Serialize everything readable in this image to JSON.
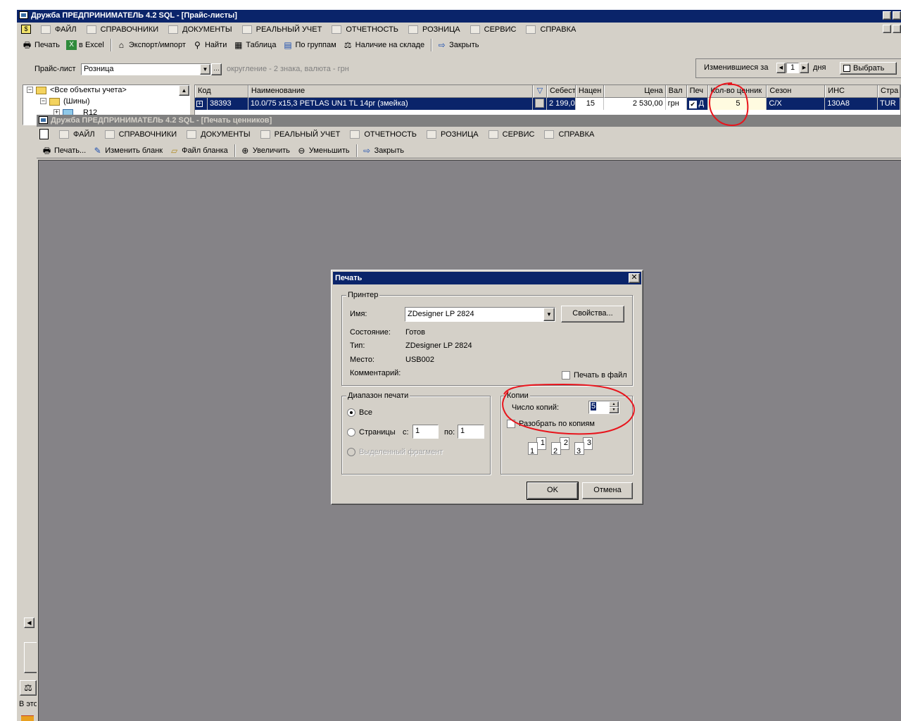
{
  "main_window": {
    "title": "Дружба  ПРЕДПРИНИМАТЕЛЬ 4.2 SQL - [Прайс-листы]",
    "menu": [
      "ФАЙЛ",
      "СПРАВОЧНИКИ",
      "ДОКУМЕНТЫ",
      "РЕАЛЬНЫЙ УЧЕТ",
      "ОТЧЕТНОСТЬ",
      "РОЗНИЦА",
      "СЕРВИС",
      "СПРАВКА"
    ],
    "toolbar": [
      "Печать",
      "в Excel",
      "Экспорт/импорт",
      "Найти",
      "Таблица",
      "По группам",
      "Наличие на складе",
      "Закрыть"
    ],
    "pricelist_label": "Прайс-лист",
    "pricelist_value": "Розница",
    "rounding_info": "округление - 2 знака, валюта - грн",
    "changed_label": "Изменившиеся за",
    "changed_days": "1",
    "days_label": "дня",
    "choose_label": "Выбрать",
    "tree": {
      "root": "<Все объекты учета>",
      "child": "(Шины)",
      "leaf": "R12"
    },
    "grid": {
      "columns": [
        "Код",
        "Наименование",
        "Себест",
        "Нацен",
        "Цена",
        "Вал",
        "Печ",
        "Кол-во ценник",
        "Сезон",
        "ИНС",
        "Стра"
      ],
      "row": {
        "code": "38393",
        "name": "10.0/75  x15,3 PETLAS UN1 TL 14pr (змейка)",
        "cost": "2 199,0",
        "markup": "15",
        "price": "2 530,00",
        "currency": "грн",
        "print": "Д",
        "qty": "5",
        "season": "C/X",
        "ins": "130A8",
        "country": "TUR"
      }
    },
    "status_partial": "В это"
  },
  "print_window": {
    "title": "Дружба  ПРЕДПРИНИМАТЕЛЬ 4.2 SQL - [Печать ценников]",
    "menu": [
      "ФАЙЛ",
      "СПРАВОЧНИКИ",
      "ДОКУМЕНТЫ",
      "РЕАЛЬНЫЙ УЧЕТ",
      "ОТЧЕТНОСТЬ",
      "РОЗНИЦА",
      "СЕРВИС",
      "СПРАВКА"
    ],
    "toolbar": [
      "Печать...",
      "Изменить бланк",
      "Файл бланка",
      "Увеличить",
      "Уменьшить",
      "Закрыть"
    ]
  },
  "dialog": {
    "title": "Печать",
    "printer_group": "Принтер",
    "name_label": "Имя:",
    "printer_name": "ZDesigner LP 2824",
    "properties_button": "Свойства...",
    "status_label": "Состояние:",
    "status_value": "Готов",
    "type_label": "Тип:",
    "type_value": "ZDesigner LP 2824",
    "where_label": "Место:",
    "where_value": "USB002",
    "comment_label": "Комментарий:",
    "print_to_file": "Печать в файл",
    "range_group": "Диапазон печати",
    "range_all": "Все",
    "range_pages": "Страницы",
    "from_label": "с:",
    "from_value": "1",
    "to_label": "по:",
    "to_value": "1",
    "range_selection": "Выделенный фрагмент",
    "copies_group": "Копии",
    "copies_label": "Число копий:",
    "copies_value": "5",
    "collate_label": "Разобрать по копиям",
    "collate_pages": [
      "1",
      "1",
      "2",
      "2",
      "3",
      "3"
    ],
    "ok_button": "OK",
    "cancel_button": "Отмена"
  },
  "colors": {
    "active_title": "#0a246a",
    "inactive_title": "#808080",
    "face": "#d4d0c8",
    "workspace": "#858387",
    "annotation": "#e8141c"
  }
}
